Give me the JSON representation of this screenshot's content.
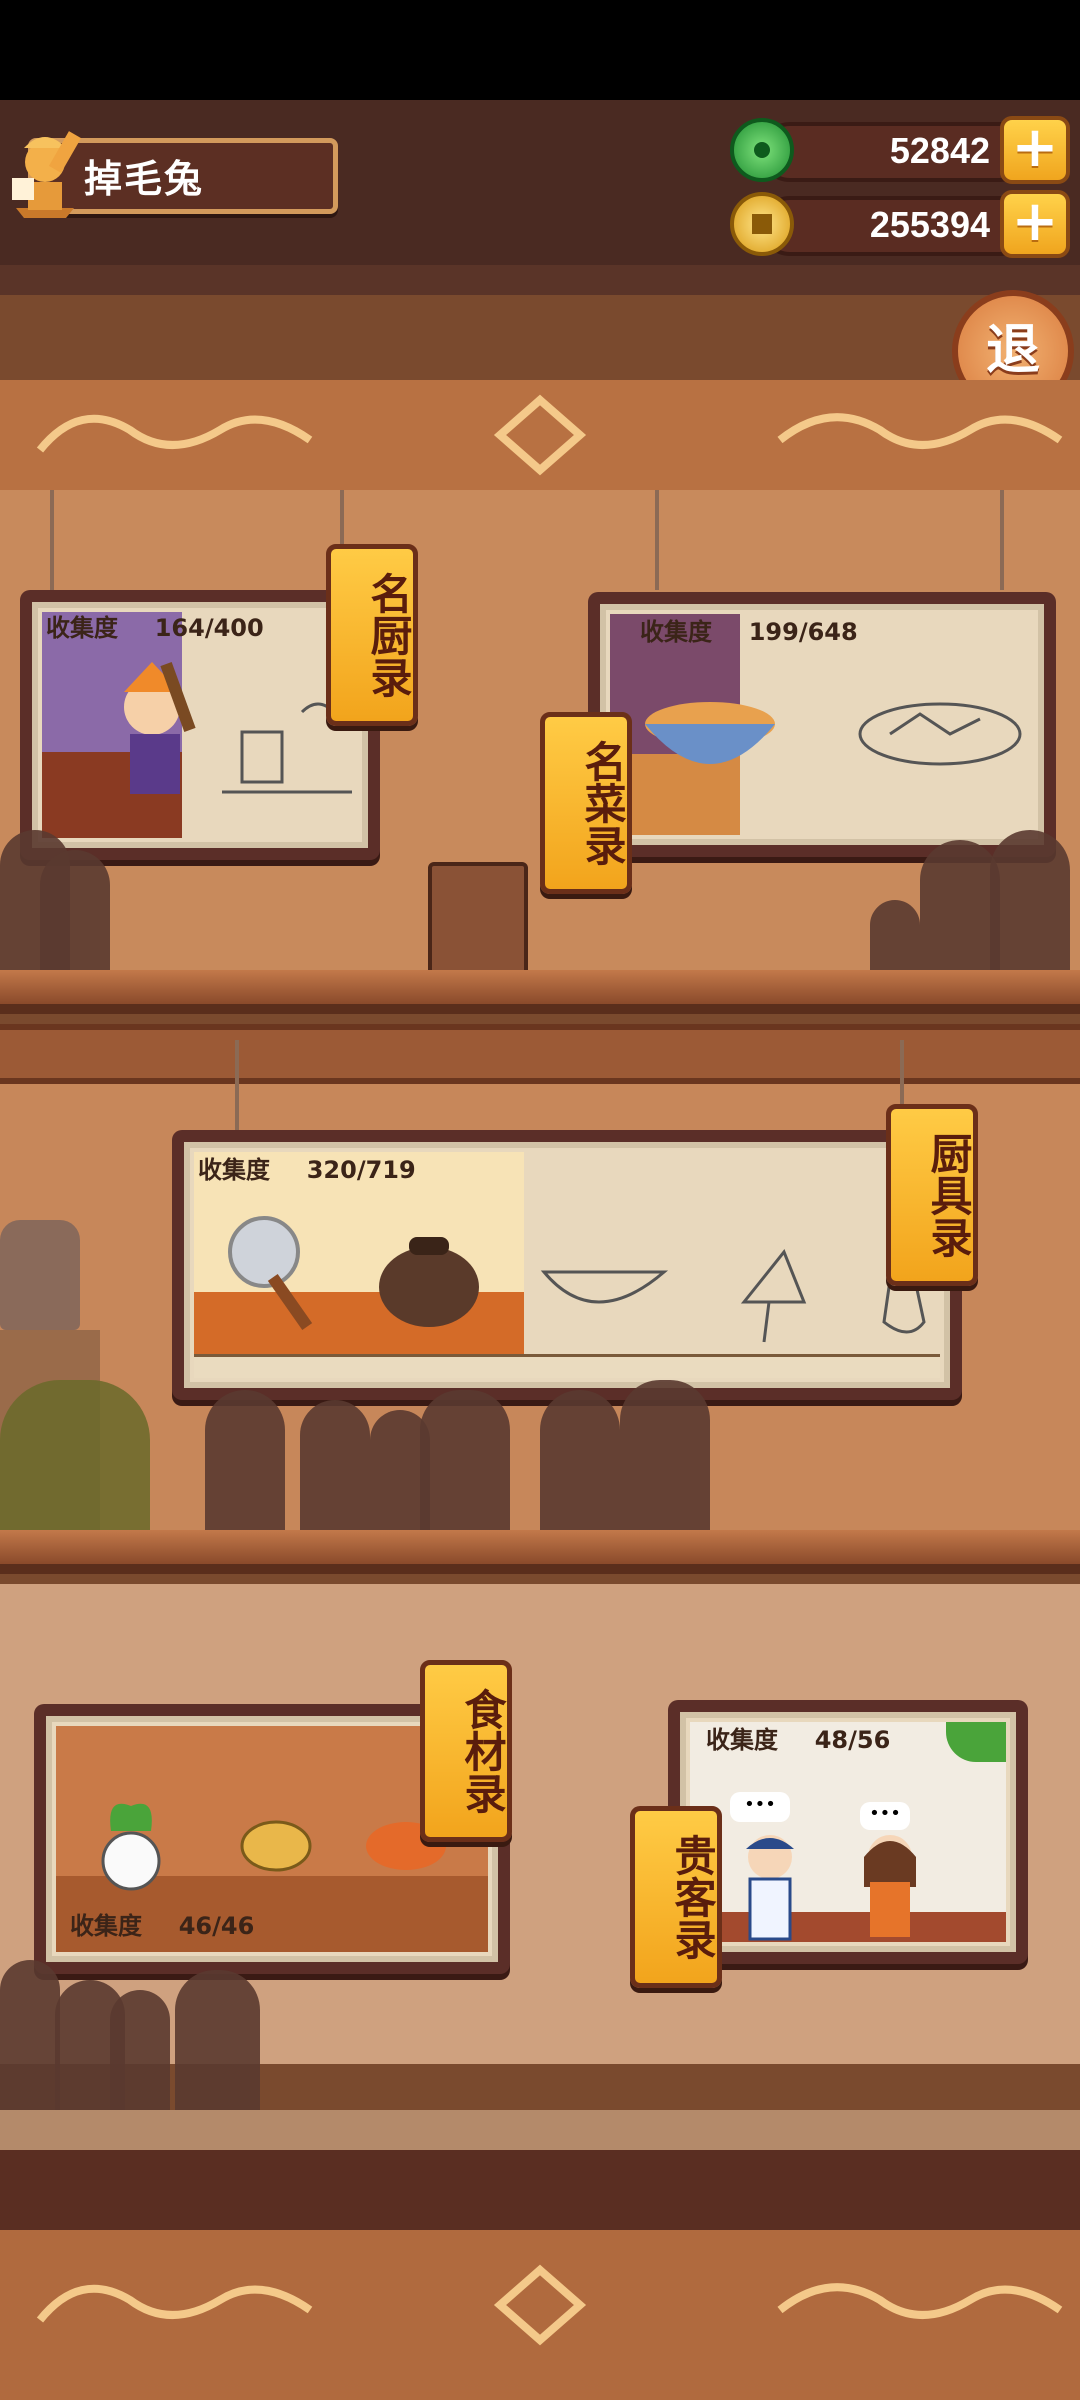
{
  "player": {
    "name": "掉毛兔",
    "avatar_icon": "chef-trophy-icon"
  },
  "currencies": [
    {
      "name": "jade",
      "icon": "jade-coin-icon",
      "value": "52842",
      "color": "#2fb04a"
    },
    {
      "name": "gold",
      "icon": "gold-coin-icon",
      "value": "255394",
      "color": "#f2c230"
    }
  ],
  "exit_button": {
    "label": "退"
  },
  "collections": [
    {
      "id": "chefs",
      "tag": "名厨录",
      "progress_label": "收集度",
      "progress": "164/400"
    },
    {
      "id": "dishes",
      "tag": "名菜录",
      "progress_label": "收集度",
      "progress": "199/648"
    },
    {
      "id": "utensils",
      "tag": "厨具录",
      "progress_label": "收集度",
      "progress": "320/719"
    },
    {
      "id": "ingredients",
      "tag": "食材录",
      "progress_label": "收集度",
      "progress": "46/46"
    },
    {
      "id": "guests",
      "tag": "贵客录",
      "progress_label": "收集度",
      "progress": "48/56"
    }
  ],
  "guest_bubbles": [
    "•••",
    "•••"
  ],
  "colors": {
    "accent": "#f2a41c",
    "wall": "#c98a5a",
    "frame": "#5b2e28"
  }
}
